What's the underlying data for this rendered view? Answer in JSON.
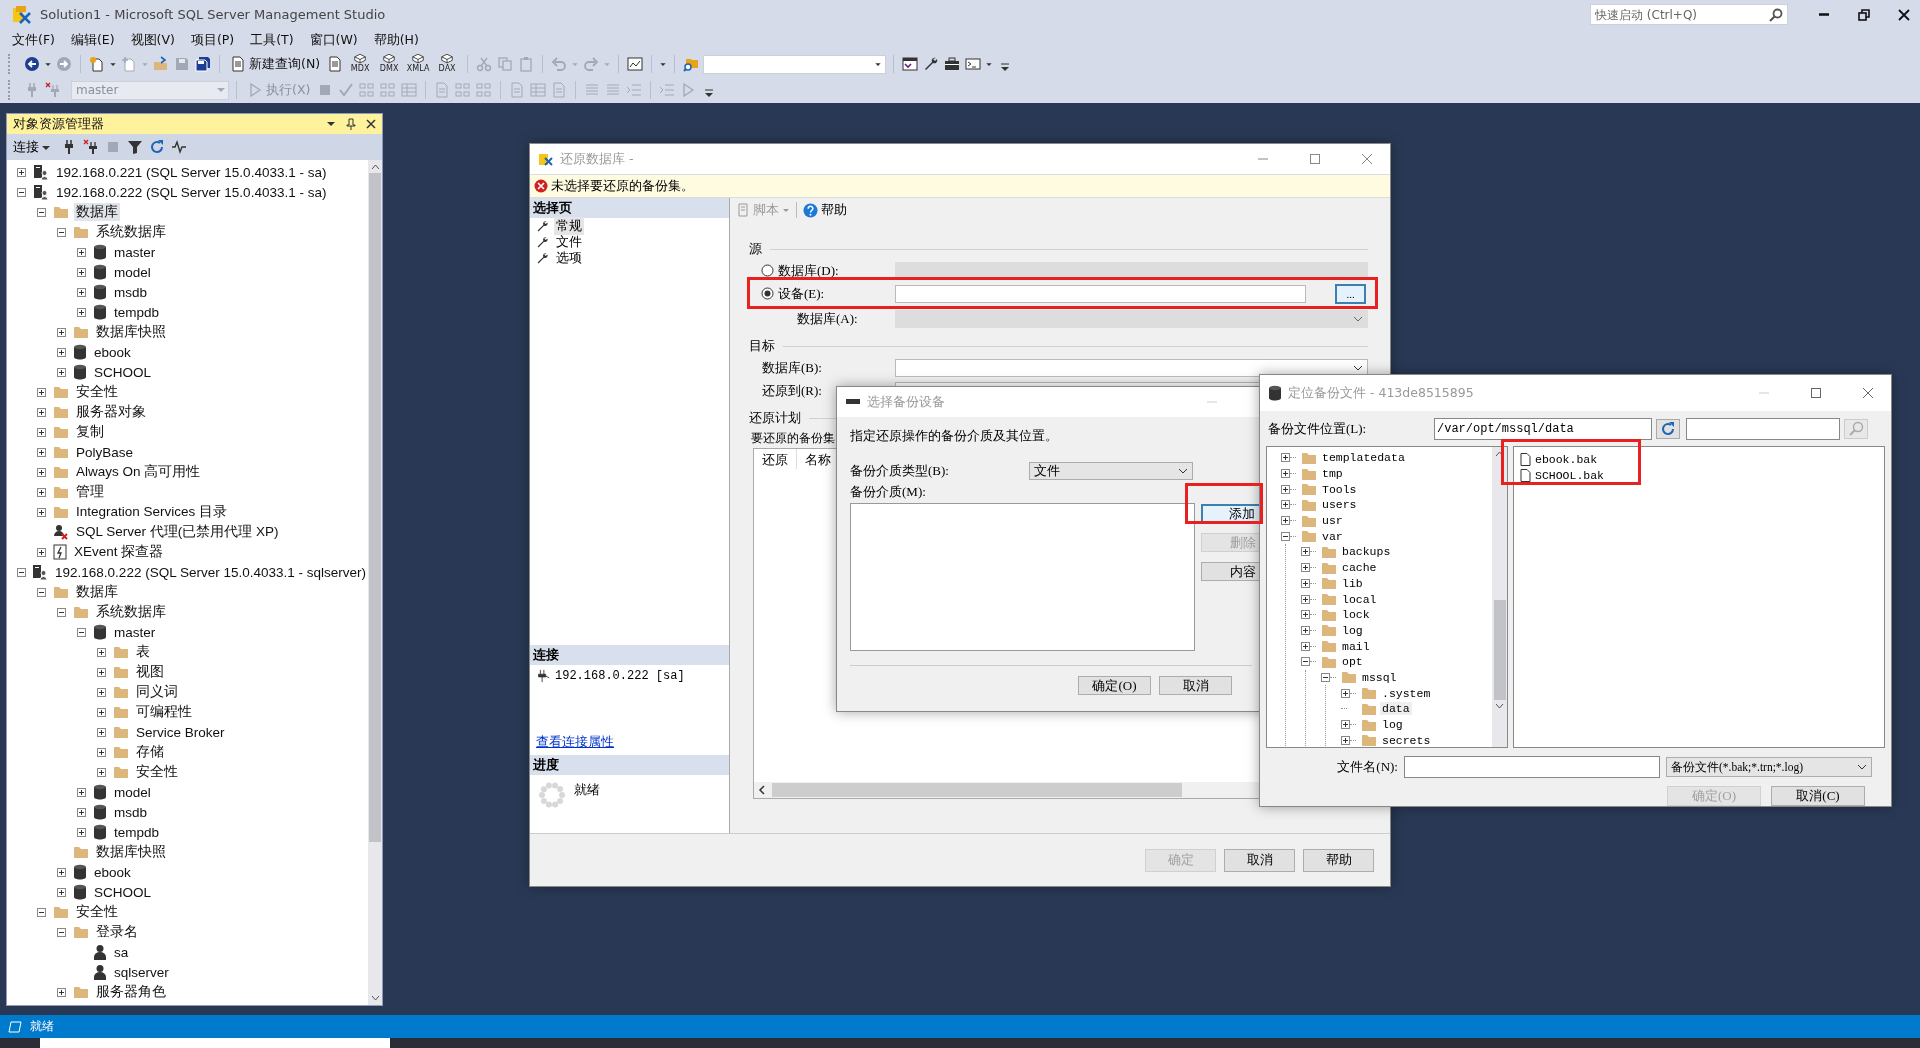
{
  "window": {
    "title": "Solution1 - Microsoft SQL Server Management Studio",
    "quick_launch": {
      "placeholder": "快速启动 (Ctrl+Q)"
    }
  },
  "menu": [
    "文件(F)",
    "编辑(E)",
    "视图(V)",
    "项目(P)",
    "工具(T)",
    "窗口(W)",
    "帮助(H)"
  ],
  "toolbar": {
    "new_query": "新建查询(N)",
    "query_types": [
      "MDX",
      "DMX",
      "XMLA",
      "DAX"
    ],
    "database": "master",
    "execute": "执行(X)"
  },
  "object_explorer": {
    "title": "对象资源管理器",
    "connect": "连接",
    "tree": [
      {
        "kind": "server",
        "label": "192.168.0.221 (SQL Server 15.0.4033.1 - sa)",
        "expanded": false,
        "selected": false
      },
      {
        "kind": "server",
        "label": "192.168.0.222 (SQL Server 15.0.4033.1 - sa)",
        "expanded": true,
        "selected": false,
        "children": [
          {
            "kind": "folder",
            "label": "数据库",
            "expanded": true,
            "selected": true,
            "children": [
              {
                "kind": "folder",
                "label": "系统数据库",
                "expanded": true,
                "selected": false,
                "children": [
                  {
                    "kind": "database",
                    "label": "master",
                    "expanded": false,
                    "selected": false
                  },
                  {
                    "kind": "database",
                    "label": "model",
                    "expanded": false,
                    "selected": false
                  },
                  {
                    "kind": "database",
                    "label": "msdb",
                    "expanded": false,
                    "selected": false
                  },
                  {
                    "kind": "database",
                    "label": "tempdb",
                    "expanded": false,
                    "selected": false
                  }
                ]
              },
              {
                "kind": "folder",
                "label": "数据库快照",
                "expanded": false,
                "selected": false
              },
              {
                "kind": "database",
                "label": "ebook",
                "expanded": false,
                "selected": false
              },
              {
                "kind": "database",
                "label": "SCHOOL",
                "expanded": false,
                "selected": false
              }
            ]
          },
          {
            "kind": "folder",
            "label": "安全性",
            "expanded": false,
            "selected": false
          },
          {
            "kind": "folder",
            "label": "服务器对象",
            "expanded": false,
            "selected": false
          },
          {
            "kind": "folder",
            "label": "复制",
            "expanded": false,
            "selected": false
          },
          {
            "kind": "folder",
            "label": "PolyBase",
            "expanded": false,
            "selected": false
          },
          {
            "kind": "folder",
            "label": "Always On 高可用性",
            "expanded": false,
            "selected": false
          },
          {
            "kind": "folder",
            "label": "管理",
            "expanded": false,
            "selected": false
          },
          {
            "kind": "folder",
            "label": "Integration Services 目录",
            "expanded": false,
            "selected": false
          },
          {
            "kind": "agent",
            "label": "SQL Server 代理(已禁用代理 XP)",
            "selected": false
          },
          {
            "kind": "xevent",
            "label": "XEvent 探查器",
            "expanded": false,
            "selected": false
          }
        ]
      },
      {
        "kind": "server",
        "label": "192.168.0.222 (SQL Server 15.0.4033.1 - sqlserver)",
        "expanded": true,
        "selected": false,
        "children": [
          {
            "kind": "folder",
            "label": "数据库",
            "expanded": true,
            "selected": false,
            "children": [
              {
                "kind": "folder",
                "label": "系统数据库",
                "expanded": true,
                "selected": false,
                "children": [
                  {
                    "kind": "database",
                    "label": "master",
                    "expanded": true,
                    "selected": false,
                    "children": [
                      {
                        "kind": "folder",
                        "label": "表",
                        "expanded": false,
                        "selected": false
                      },
                      {
                        "kind": "folder",
                        "label": "视图",
                        "expanded": false,
                        "selected": false
                      },
                      {
                        "kind": "folder",
                        "label": "同义词",
                        "expanded": false,
                        "selected": false
                      },
                      {
                        "kind": "folder",
                        "label": "可编程性",
                        "expanded": false,
                        "selected": false
                      },
                      {
                        "kind": "folder",
                        "label": "Service Broker",
                        "expanded": false,
                        "selected": false
                      },
                      {
                        "kind": "folder",
                        "label": "存储",
                        "expanded": false,
                        "selected": false
                      },
                      {
                        "kind": "folder",
                        "label": "安全性",
                        "expanded": false,
                        "selected": false
                      }
                    ]
                  },
                  {
                    "kind": "database",
                    "label": "model",
                    "expanded": false,
                    "selected": false
                  },
                  {
                    "kind": "database",
                    "label": "msdb",
                    "expanded": false,
                    "selected": false
                  },
                  {
                    "kind": "database",
                    "label": "tempdb",
                    "expanded": false,
                    "selected": false
                  }
                ]
              },
              {
                "kind": "folder",
                "label": "数据库快照",
                "selected": false
              },
              {
                "kind": "database",
                "label": "ebook",
                "expanded": false,
                "selected": false
              },
              {
                "kind": "database",
                "label": "SCHOOL",
                "expanded": false,
                "selected": false
              }
            ]
          },
          {
            "kind": "folder",
            "label": "安全性",
            "expanded": true,
            "selected": false,
            "children": [
              {
                "kind": "folder",
                "label": "登录名",
                "expanded": true,
                "selected": false,
                "children": [
                  {
                    "kind": "login",
                    "label": "sa",
                    "selected": false
                  },
                  {
                    "kind": "login",
                    "label": "sqlserver",
                    "selected": false
                  }
                ]
              },
              {
                "kind": "folder",
                "label": "服务器角色",
                "expanded": false,
                "selected": false
              }
            ]
          }
        ]
      }
    ]
  },
  "restore_dialog": {
    "title": "还原数据库 -",
    "warning": "未选择要还原的备份集。",
    "pages_header": "选择页",
    "pages": [
      {
        "label": "常规",
        "selected": true
      },
      {
        "label": "文件",
        "selected": false
      },
      {
        "label": "选项",
        "selected": false
      }
    ],
    "connection_header": "连接",
    "connection": "192.168.0.222 [sa]",
    "connection_link": "查看连接属性",
    "progress_header": "进度",
    "progress_status": "就绪",
    "toolbar": {
      "script": "脚本",
      "help": "帮助"
    },
    "source": {
      "label": "源",
      "options": [
        {
          "label": "数据库(D):",
          "selected": false
        },
        {
          "label": "设备(E):",
          "selected": true
        }
      ],
      "browse": "...",
      "database_label": "数据库(A):"
    },
    "target": {
      "label": "目标",
      "database_label": "数据库(B):",
      "restore_to_label": "还原到(R):"
    },
    "plan": {
      "label": "还原计划",
      "sets_label": "要还原的备份集",
      "columns": [
        "还原",
        "名称"
      ]
    },
    "buttons": [
      {
        "label": "确定",
        "disabled": true
      },
      {
        "label": "取消",
        "disabled": false
      },
      {
        "label": "帮助",
        "disabled": false
      }
    ]
  },
  "device_dialog": {
    "title": "选择备份设备",
    "instruction": "指定还原操作的备份介质及其位置。",
    "media_type_label": "备份介质类型(B):",
    "media_type": "文件",
    "media_label": "备份介质(M):",
    "side_buttons": [
      {
        "label": "添加",
        "disabled": false,
        "focused": true
      },
      {
        "label": "删除",
        "disabled": true,
        "focused": false
      },
      {
        "label": "内容",
        "disabled": false,
        "focused": false
      }
    ],
    "buttons": [
      "确定(O)",
      "取消"
    ]
  },
  "locate_dialog": {
    "title": "定位备份文件 - 413de8515895",
    "location_label": "备份文件位置(L):",
    "location": "/var/opt/mssql/data",
    "tree": [
      {
        "label": "templatedata",
        "expanded": false,
        "selected": false
      },
      {
        "label": "tmp",
        "expanded": false,
        "selected": false
      },
      {
        "label": "Tools",
        "expanded": false,
        "selected": false
      },
      {
        "label": "users",
        "expanded": false,
        "selected": false
      },
      {
        "label": "usr",
        "expanded": false,
        "selected": false
      },
      {
        "label": "var",
        "expanded": true,
        "selected": false,
        "children": [
          {
            "label": "backups",
            "expanded": false,
            "selected": false
          },
          {
            "label": "cache",
            "expanded": false,
            "selected": false
          },
          {
            "label": "lib",
            "expanded": false,
            "selected": false
          },
          {
            "label": "local",
            "expanded": false,
            "selected": false
          },
          {
            "label": "lock",
            "expanded": false,
            "selected": false
          },
          {
            "label": "log",
            "expanded": false,
            "selected": false
          },
          {
            "label": "mail",
            "expanded": false,
            "selected": false
          },
          {
            "label": "opt",
            "expanded": true,
            "selected": false,
            "children": [
              {
                "label": "mssql",
                "expanded": true,
                "selected": false,
                "children": [
                  {
                    "label": ".system",
                    "expanded": false,
                    "selected": false
                  },
                  {
                    "label": "data",
                    "selected": true
                  },
                  {
                    "label": "log",
                    "expanded": false,
                    "selected": false
                  },
                  {
                    "label": "secrets",
                    "expanded": false,
                    "selected": false
                  }
                ]
              }
            ]
          }
        ]
      }
    ],
    "files": [
      "ebook.bak",
      "SCHOOL.bak"
    ],
    "file_name_label": "文件名(N):",
    "filter": "备份文件(*.bak;*.trn;*.log)",
    "buttons": [
      {
        "label": "确定(O)",
        "disabled": true
      },
      {
        "label": "取消(C)",
        "disabled": false
      }
    ]
  },
  "status_bar": "就绪"
}
